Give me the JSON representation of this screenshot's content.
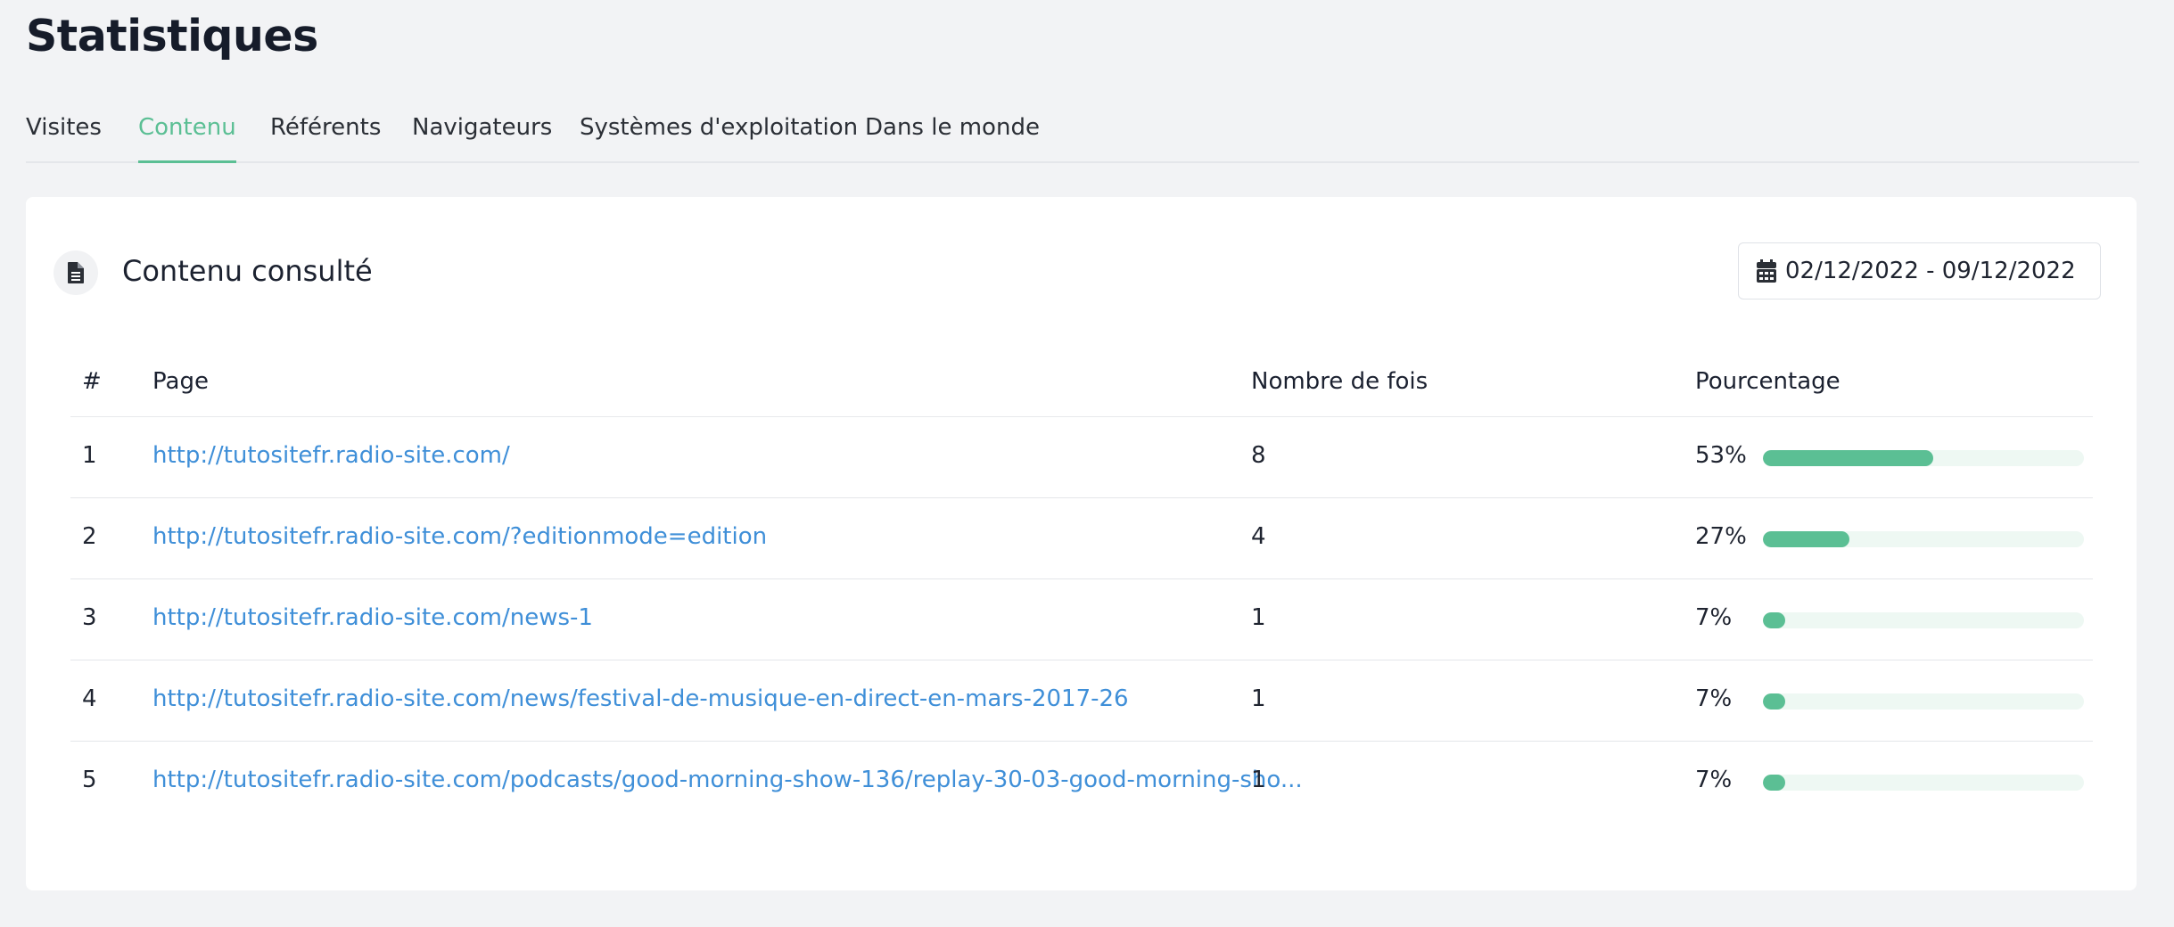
{
  "page": {
    "title": "Statistiques"
  },
  "tabs": [
    {
      "label": "Visites",
      "active": false
    },
    {
      "label": "Contenu",
      "active": true
    },
    {
      "label": "Référents",
      "active": false
    },
    {
      "label": "Navigateurs",
      "active": false
    },
    {
      "label": "Systèmes d'exploitation",
      "active": false
    },
    {
      "label": "Dans le monde",
      "active": false
    }
  ],
  "card": {
    "icon": "document-icon",
    "title": "Contenu consulté",
    "date_range": "02/12/2022 - 09/12/2022",
    "date_icon": "calendar-icon"
  },
  "table": {
    "headers": {
      "index": "#",
      "page": "Page",
      "count": "Nombre de fois",
      "percent": "Pourcentage"
    },
    "rows": [
      {
        "index": "1",
        "page": "http://tutositefr.radio-site.com/",
        "count": "8",
        "percent": "53%",
        "fraction": 0.53
      },
      {
        "index": "2",
        "page": "http://tutositefr.radio-site.com/?editionmode=edition",
        "count": "4",
        "percent": "27%",
        "fraction": 0.27
      },
      {
        "index": "3",
        "page": "http://tutositefr.radio-site.com/news-1",
        "count": "1",
        "percent": "7%",
        "fraction": 0.07
      },
      {
        "index": "4",
        "page": "http://tutositefr.radio-site.com/news/festival-de-musique-en-direct-en-mars-2017-26",
        "count": "1",
        "percent": "7%",
        "fraction": 0.07
      },
      {
        "index": "5",
        "page": "http://tutositefr.radio-site.com/podcasts/good-morning-show-136/replay-30-03-good-morning-sho...",
        "count": "1",
        "percent": "7%",
        "fraction": 0.07
      }
    ]
  },
  "colors": {
    "accent": "#5bbf94",
    "link": "#3f8fd8",
    "bar_track": "#eef8f3",
    "background": "#f2f3f5"
  }
}
